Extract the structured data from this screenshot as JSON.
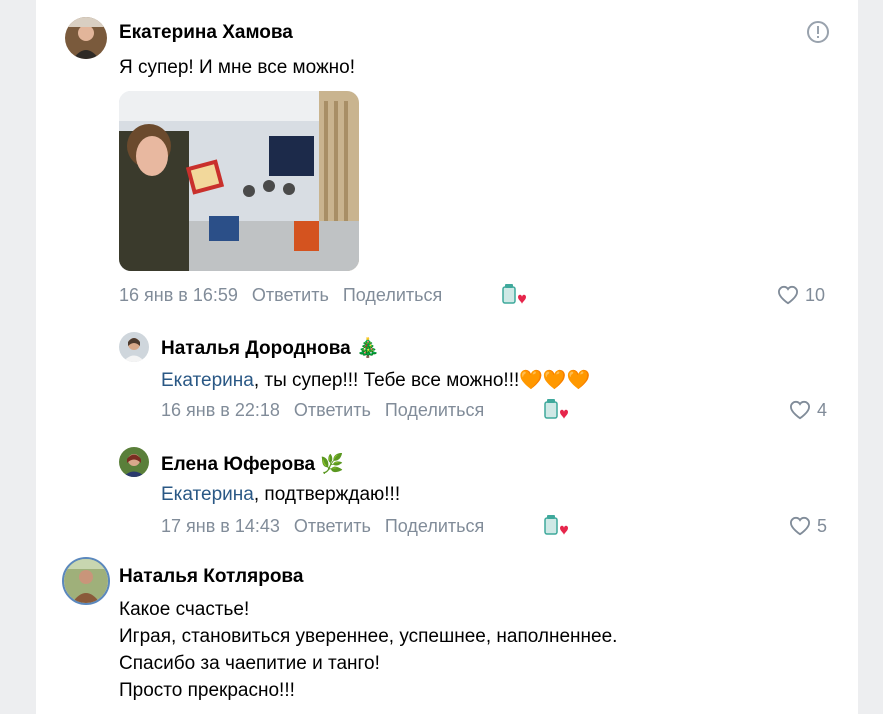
{
  "comments": [
    {
      "author": "Екатерина Хамова",
      "text": "Я супер! И мне все можно!",
      "date": "16 янв в 16:59",
      "reply": "Ответить",
      "share": "Поделиться",
      "likes": "10",
      "replies": [
        {
          "author": "Наталья Дороднова",
          "author_emoji": "🎄",
          "mention": "Екатерина",
          "text": ", ты супер!!! Тебе все можно!!!",
          "hearts": "🧡🧡🧡",
          "date": "16 янв в 22:18",
          "reply": "Ответить",
          "share": "Поделиться",
          "likes": "4"
        },
        {
          "author": "Елена Юферова",
          "author_emoji": "🌿",
          "mention": "Екатерина",
          "text": ", подтверждаю!!!",
          "date": "17 янв в 14:43",
          "reply": "Ответить",
          "share": "Поделиться",
          "likes": "5"
        }
      ]
    },
    {
      "author": "Наталья Котлярова",
      "lines": [
        "Какое счастье!",
        "Играя, становиться увереннее, успешнее, наполненнее.",
        "Спасибо за чаепитие и танго!",
        "Просто прекрасно!!!"
      ]
    }
  ],
  "colors": {
    "link": "#2a5885",
    "meta": "#818c99",
    "background": "#edeef0"
  }
}
